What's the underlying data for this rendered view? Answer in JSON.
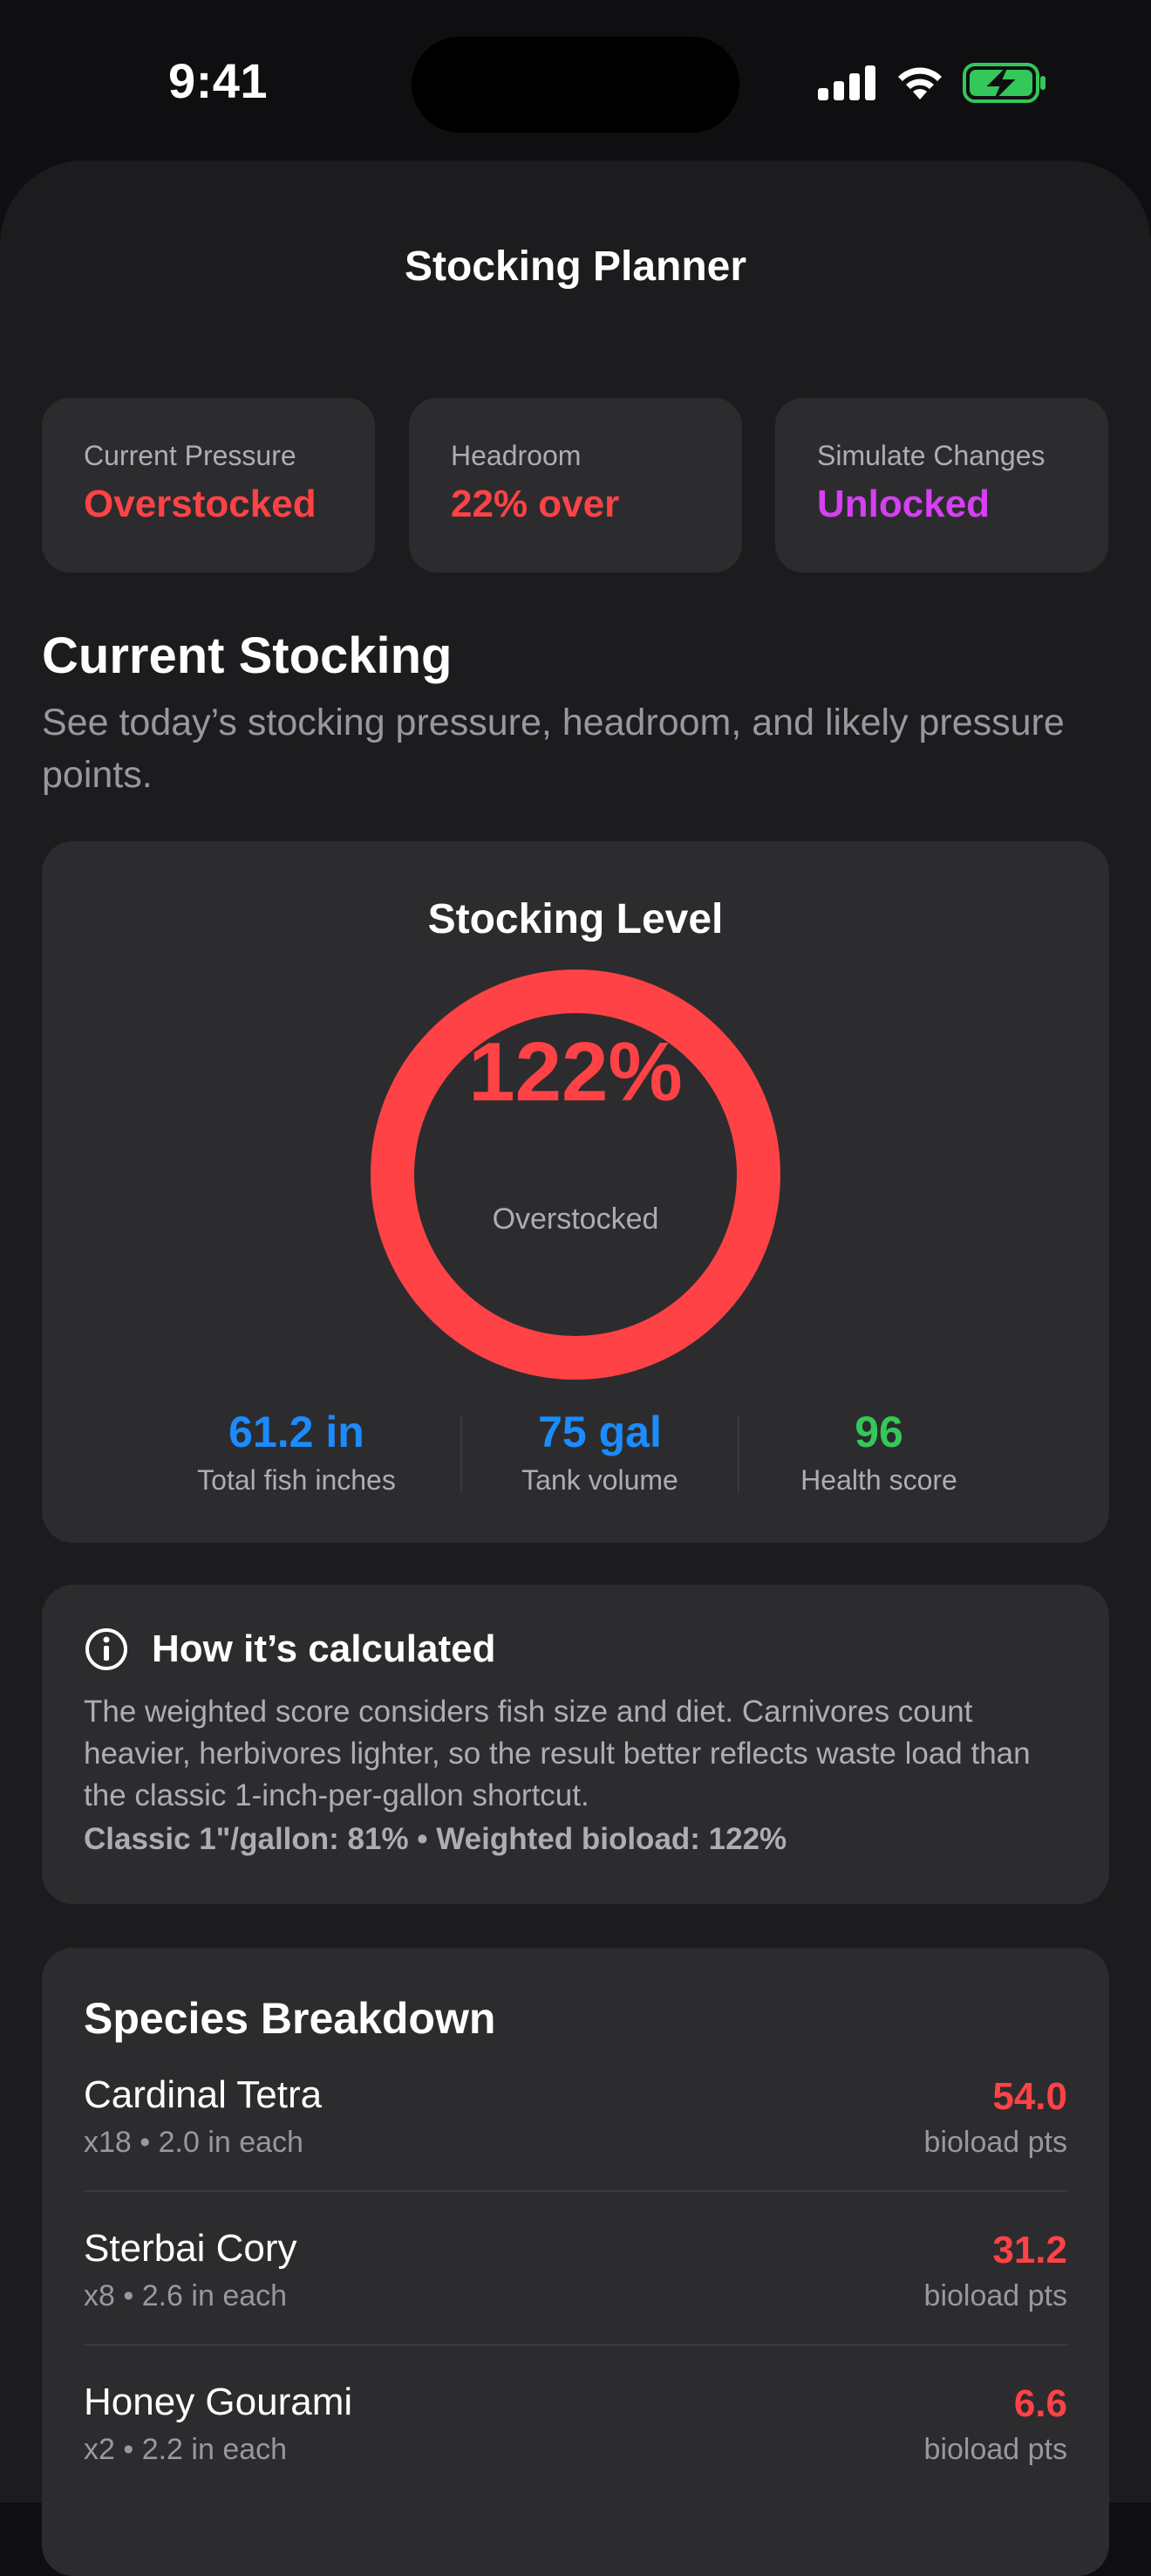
{
  "status_bar": {
    "time": "9:41"
  },
  "nav": {
    "title": "Stocking Planner"
  },
  "chips": [
    {
      "label": "Current Pressure",
      "value": "Overstocked",
      "color": "#ff4245"
    },
    {
      "label": "Headroom",
      "value": "22% over",
      "color": "#ff4245"
    },
    {
      "label": "Simulate Changes",
      "value": "Unlocked",
      "color": "#d63ff2"
    }
  ],
  "section": {
    "title": "Current Stocking",
    "subtitle": "See today’s stocking pressure, headroom, and likely pressure points."
  },
  "gauge": {
    "title": "Stocking Level",
    "percent_text": "122%",
    "status": "Overstocked",
    "fill_fraction": 1.0,
    "color": "#ff4245"
  },
  "metrics": [
    {
      "value": "61.2 in",
      "label": "Total fish inches",
      "color": "#1a8cff"
    },
    {
      "value": "75 gal",
      "label": "Tank volume",
      "color": "#1a8cff"
    },
    {
      "value": "96",
      "label": "Health score",
      "color": "#34c759"
    }
  ],
  "info": {
    "icon": "info-circle-icon",
    "title": "How it’s calculated",
    "body": "The weighted score considers fish size and diet. Carnivores count heavier, herbivores lighter, so the result better reflects waste load than the classic 1-inch-per-gallon shortcut.",
    "footer": "Classic 1\"/gallon: 81% • Weighted bioload: 122%"
  },
  "breakdown": {
    "title": "Species Breakdown",
    "unit": "bioload pts",
    "species": [
      {
        "name": "Cardinal Tetra",
        "detail": "x18 • 2.0 in each",
        "points": "54.0"
      },
      {
        "name": "Sterbai Cory",
        "detail": "x8 • 2.6 in each",
        "points": "31.2"
      },
      {
        "name": "Honey Gourami",
        "detail": "x2 • 2.2 in each",
        "points": "6.6"
      }
    ]
  }
}
